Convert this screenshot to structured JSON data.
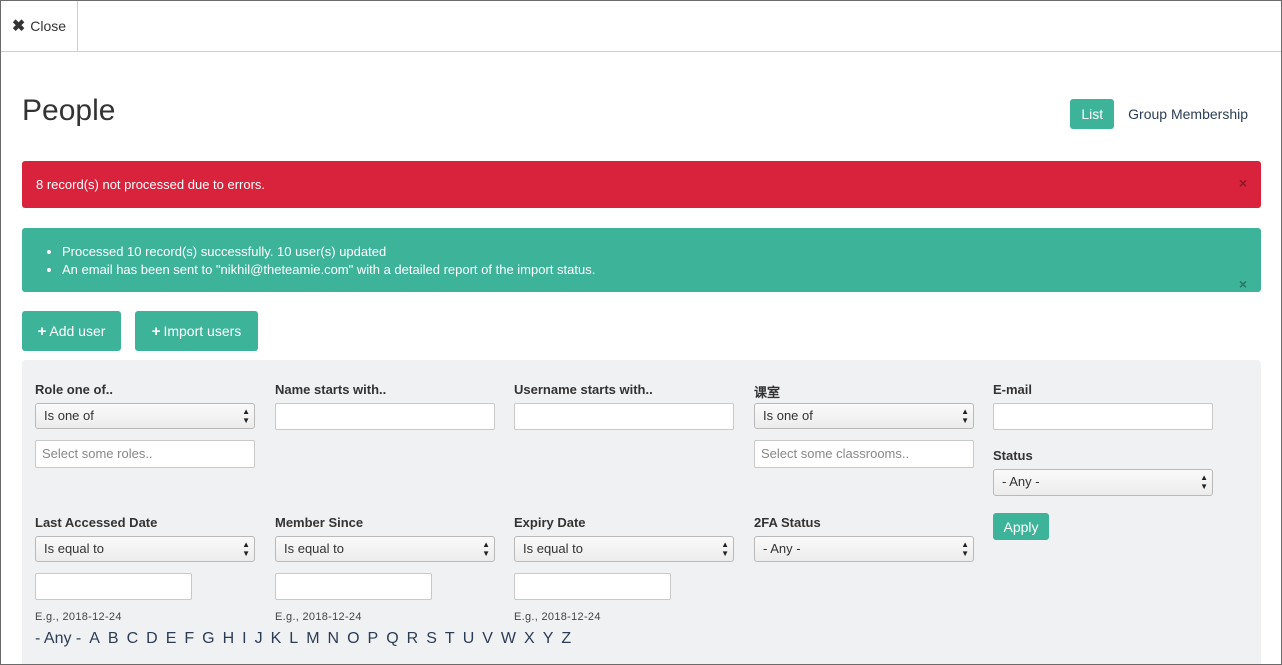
{
  "topbar": {
    "close_label": "Close"
  },
  "page": {
    "title": "People"
  },
  "view_toggle": {
    "list_label": "List",
    "group_label": "Group Membership"
  },
  "alerts": {
    "error_text": "8 record(s) not processed due to errors.",
    "success_items": [
      "Processed 10 record(s) successfully. 10 user(s) updated",
      "An email has been sent to \"nikhil@theteamie.com\" with a detailed report of the import status."
    ],
    "close_glyph": "×"
  },
  "actions": {
    "add_user": "Add user",
    "import_users": "Import users"
  },
  "filters": {
    "role": {
      "label": "Role one of..",
      "select_value": "Is one of",
      "placeholder": "Select some roles.."
    },
    "name": {
      "label": "Name starts with..",
      "value": ""
    },
    "username": {
      "label": "Username starts with..",
      "value": ""
    },
    "classroom": {
      "label": "课室",
      "select_value": "Is one of",
      "placeholder": "Select some classrooms.."
    },
    "email": {
      "label": "E-mail",
      "value": ""
    },
    "status": {
      "label": "Status",
      "select_value": "- Any -"
    },
    "last_accessed": {
      "label": "Last Accessed Date",
      "select_value": "Is equal to",
      "hint": "E.g., 2018-12-24"
    },
    "member_since": {
      "label": "Member Since",
      "select_value": "Is equal to",
      "hint": "E.g., 2018-12-24"
    },
    "expiry": {
      "label": "Expiry Date",
      "select_value": "Is equal to",
      "hint": "E.g., 2018-12-24"
    },
    "twofa": {
      "label": "2FA Status",
      "select_value": "- Any -"
    },
    "apply_label": "Apply"
  },
  "alphabet": [
    "- Any -",
    "A",
    "B",
    "C",
    "D",
    "E",
    "F",
    "G",
    "H",
    "I",
    "J",
    "K",
    "L",
    "M",
    "N",
    "O",
    "P",
    "Q",
    "R",
    "S",
    "T",
    "U",
    "V",
    "W",
    "X",
    "Y",
    "Z"
  ],
  "colors": {
    "accent": "#3db49a",
    "error": "#d9223b",
    "link": "#2b3d55",
    "panel": "#f0f1f3"
  },
  "icons": {
    "close": "close-icon",
    "plus": "plus-icon",
    "select_arrows": "select-arrows-icon"
  }
}
